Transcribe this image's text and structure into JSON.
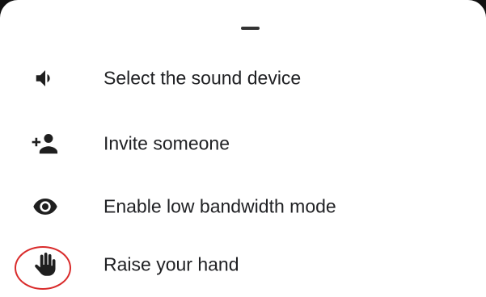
{
  "menu": {
    "items": [
      {
        "label": "Select the sound device",
        "icon": "speaker-icon"
      },
      {
        "label": "Invite someone",
        "icon": "add-person-icon"
      },
      {
        "label": "Enable low bandwidth mode",
        "icon": "eye-icon"
      },
      {
        "label": "Raise your hand",
        "icon": "hand-icon"
      }
    ]
  },
  "colors": {
    "text": "#202124",
    "icon": "#1f1f1f",
    "highlight": "#d92b2b",
    "background": "#ffffff"
  }
}
